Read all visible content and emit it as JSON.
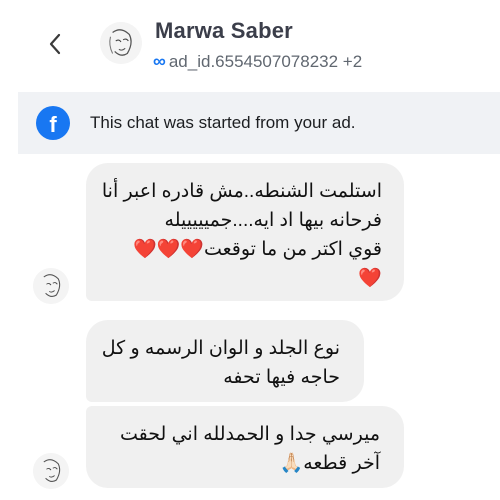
{
  "header": {
    "contact_name": "Marwa Saber",
    "ad_id": "ad_id.6554507078232 +2",
    "meta_icon": "∞"
  },
  "banner": {
    "icon_letter": "f",
    "text": "This chat was started from your ad."
  },
  "messages": [
    {
      "lines": [
        "استلمت الشنطه..مش قادره اعبر أنا",
        "فرحانه بيها اد ايه....جميييييله",
        "قوي اكتر من ما توقعت❤️❤️❤️",
        "❤️"
      ]
    },
    {
      "lines": [
        "نوع الجلد و الوان الرسمه و كل",
        "حاجه فيها تحفه"
      ]
    },
    {
      "lines": [
        "ميرسي جدا و الحمدلله اني لحقت",
        "آخر قطعه🙏🏻"
      ]
    }
  ],
  "colors": {
    "accent": "#1877f2",
    "bubble": "#f0f0f0",
    "banner": "#f0f2f5"
  }
}
